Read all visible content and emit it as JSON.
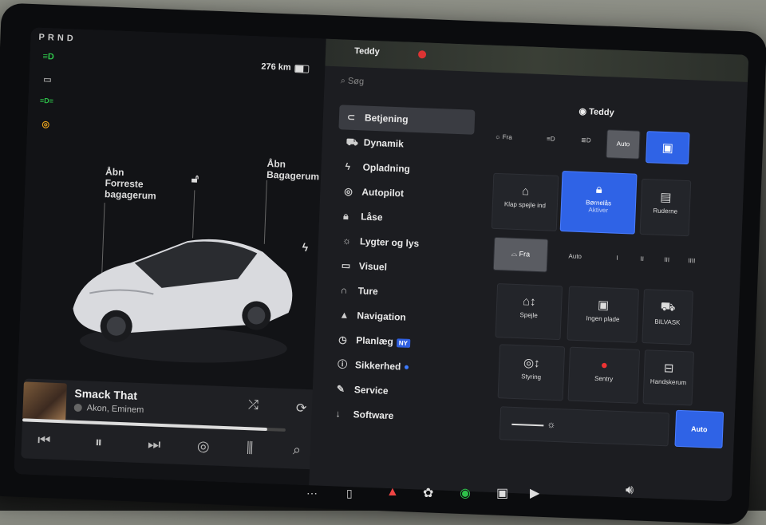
{
  "status": {
    "gear": "PRND",
    "range": "276 km"
  },
  "indicators": [
    {
      "icon": "headlight-icon",
      "color": "#2ec24a",
      "glyph": "≡D"
    },
    {
      "icon": "camera-icon",
      "color": "#9a9a9a",
      "glyph": "▭"
    },
    {
      "icon": "sidelight-icon",
      "color": "#2ec24a",
      "glyph": "≡D≡"
    },
    {
      "icon": "tire-pressure-icon",
      "color": "#e8a21c",
      "glyph": "◎"
    }
  ],
  "car_view": {
    "frunk_label": "Åbn\nForreste\nbagagerum",
    "trunk_label": "Åbn\nBagagerum"
  },
  "media": {
    "song": "Smack That",
    "artist": "Akon, Eminem",
    "progress": 0.93
  },
  "right": {
    "profile_name": "Teddy",
    "search_placeholder": "Søg",
    "menu": [
      {
        "label": "Betjening",
        "icon": "toggle-icon",
        "active": true
      },
      {
        "label": "Dynamik",
        "icon": "car-icon"
      },
      {
        "label": "Opladning",
        "icon": "bolt-icon"
      },
      {
        "label": "Autopilot",
        "icon": "steering-wheel-icon"
      },
      {
        "label": "Låse",
        "icon": "lock-icon"
      },
      {
        "label": "Lygter og lys",
        "icon": "sun-icon"
      },
      {
        "label": "Visuel",
        "icon": "display-icon"
      },
      {
        "label": "Ture",
        "icon": "route-icon"
      },
      {
        "label": "Navigation",
        "icon": "navigation-icon"
      },
      {
        "label": "Planlæg",
        "icon": "clock-icon",
        "badge": "NY"
      },
      {
        "label": "Sikkerhed",
        "icon": "info-icon",
        "dot": true
      },
      {
        "label": "Service",
        "icon": "wrench-icon"
      },
      {
        "label": "Software",
        "icon": "download-icon"
      }
    ],
    "controls": {
      "lights_row": [
        "Fra",
        "Auto"
      ],
      "fold_mirrors": "Klap spejle ind",
      "child_lock": "Børnelås",
      "child_lock_sub": "Aktiver",
      "window_lock": "Ruderne",
      "wiper_off": "Fra",
      "wiper_auto": "Auto",
      "wiper_speeds": [
        "I",
        "II",
        "III",
        "IIII"
      ],
      "mirrors": "Spejle",
      "no_plate": "Ingen plade",
      "glovebox_short": "BILVASK",
      "steering": "Styring",
      "sentry": "Sentry",
      "glovebox": "Handskerum",
      "auto_button": "Auto"
    }
  }
}
